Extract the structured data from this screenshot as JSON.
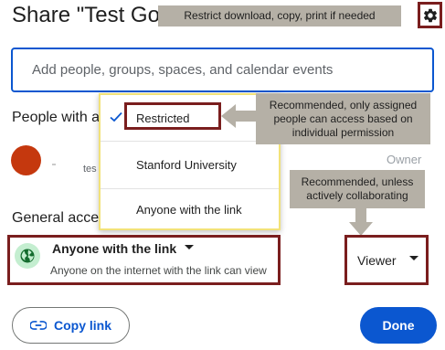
{
  "header": {
    "title": "Share \"Test Goog",
    "settings_icon": "gear-icon"
  },
  "search": {
    "placeholder": "Add people, groups, spaces, and calendar events"
  },
  "people": {
    "title": "People with a",
    "person_email_fragment": "tes",
    "owner_label": "Owner",
    "avatar_color": "#c5380e"
  },
  "access_menu": {
    "items": [
      {
        "label": "Restricted",
        "selected": true
      },
      {
        "label": "Stanford University",
        "selected": false
      },
      {
        "label": "Anyone with the link",
        "selected": false
      }
    ]
  },
  "general_access": {
    "title": "General acce",
    "selected_label": "Anyone with the link",
    "description": "Anyone on the internet with the link can view",
    "role": "Viewer"
  },
  "buttons": {
    "copy_link": "Copy link",
    "done": "Done"
  },
  "annotations": {
    "gear": "Restrict download, copy, print if needed",
    "restricted": "Recommended, only assigned people can access based on individual permission",
    "viewer": "Recommended, unless actively collaborating"
  },
  "colors": {
    "accent": "#0b57d0",
    "highlight_border": "#7a1e1e",
    "callout_bg": "#b5b0a6",
    "menu_border": "#f2e279"
  }
}
